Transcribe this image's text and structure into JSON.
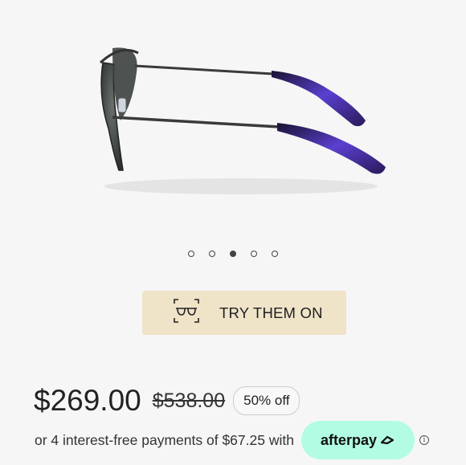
{
  "carousel": {
    "total": 5,
    "active_index": 2
  },
  "try_on": {
    "label": "TRY THEM ON",
    "icon": "glasses-scan-icon"
  },
  "pricing": {
    "current_price": "$269.00",
    "original_price": "$538.00",
    "discount": "50% off"
  },
  "installments": {
    "text": "or 4 interest-free payments of $67.25 with",
    "provider": "afterpay",
    "info_icon": "info-icon"
  },
  "colors": {
    "try_on_bg": "#efe3c8",
    "afterpay_bg": "#b2fce4",
    "page_bg": "#f6f6f6"
  }
}
